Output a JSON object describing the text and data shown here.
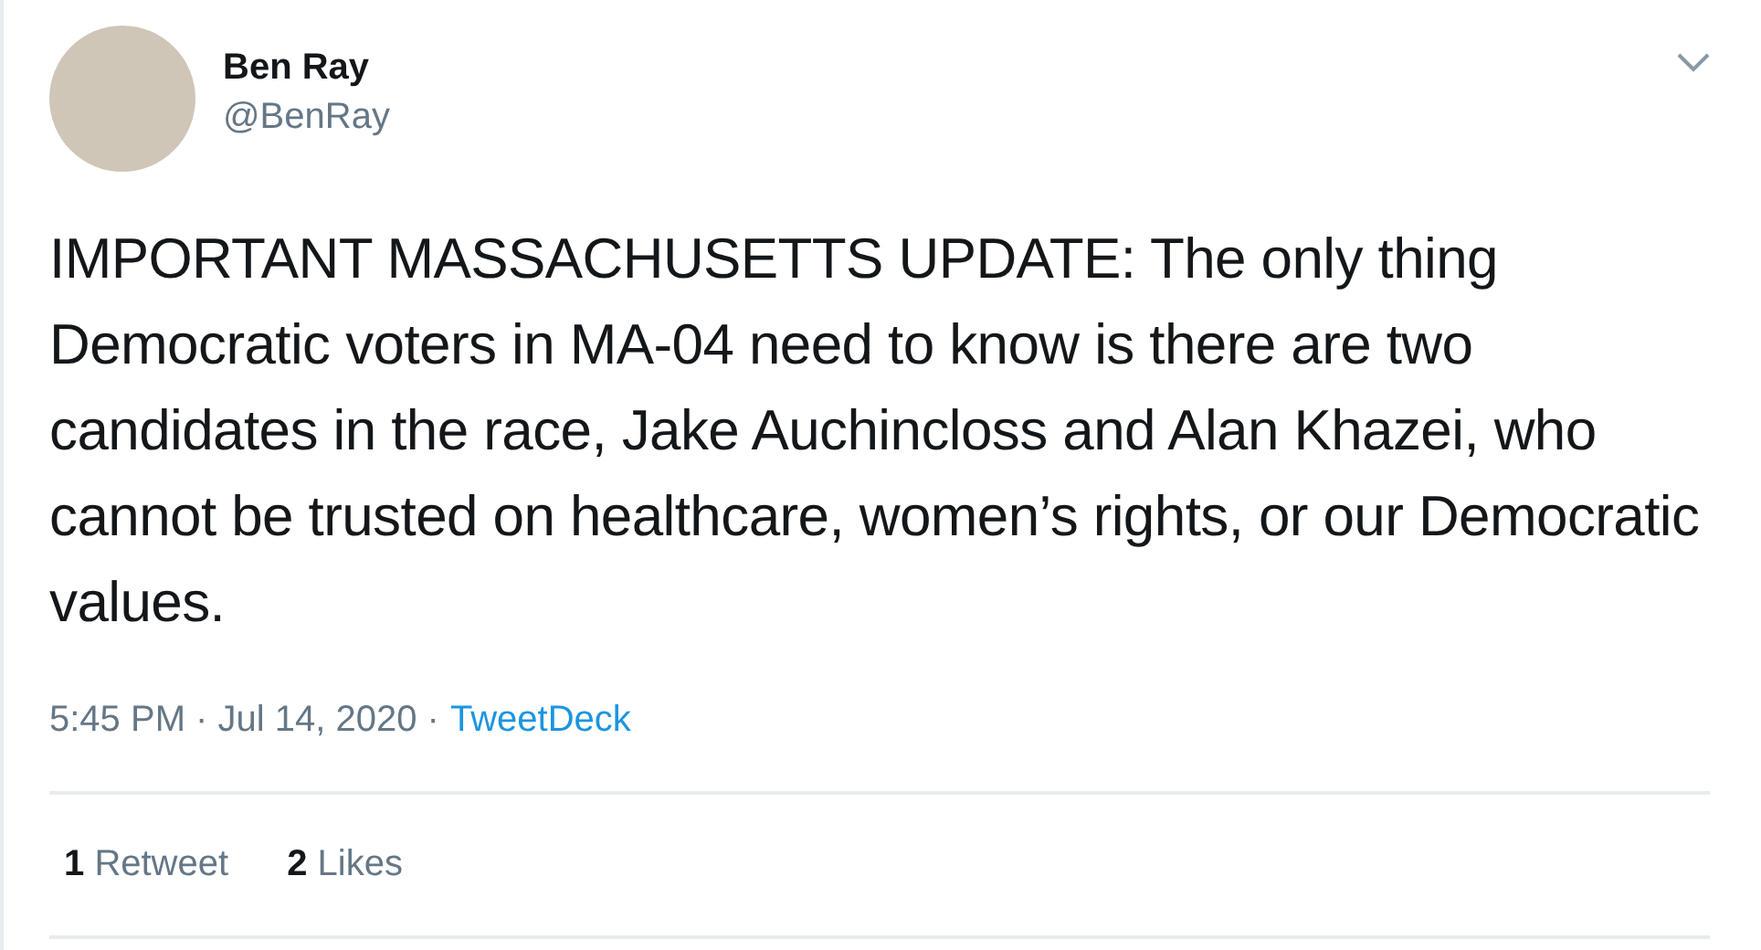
{
  "author": {
    "name": "Ben Ray",
    "handle": "@BenRay"
  },
  "text": "IMPORTANT MASSACHUSETTS UPDATE: The only thing Democratic voters in MA-04 need to know is there are two candidates in the race, Jake Auchincloss and Alan Khazei, who cannot be trusted on healthcare, women’s rights, or our Democratic values.",
  "meta": {
    "timestamp": "5:45 PM · Jul 14, 2020 ·",
    "source": "TweetDeck"
  },
  "stats": [
    {
      "count": "1",
      "label": "Retweet"
    },
    {
      "count": "2",
      "label": "Likes"
    }
  ]
}
